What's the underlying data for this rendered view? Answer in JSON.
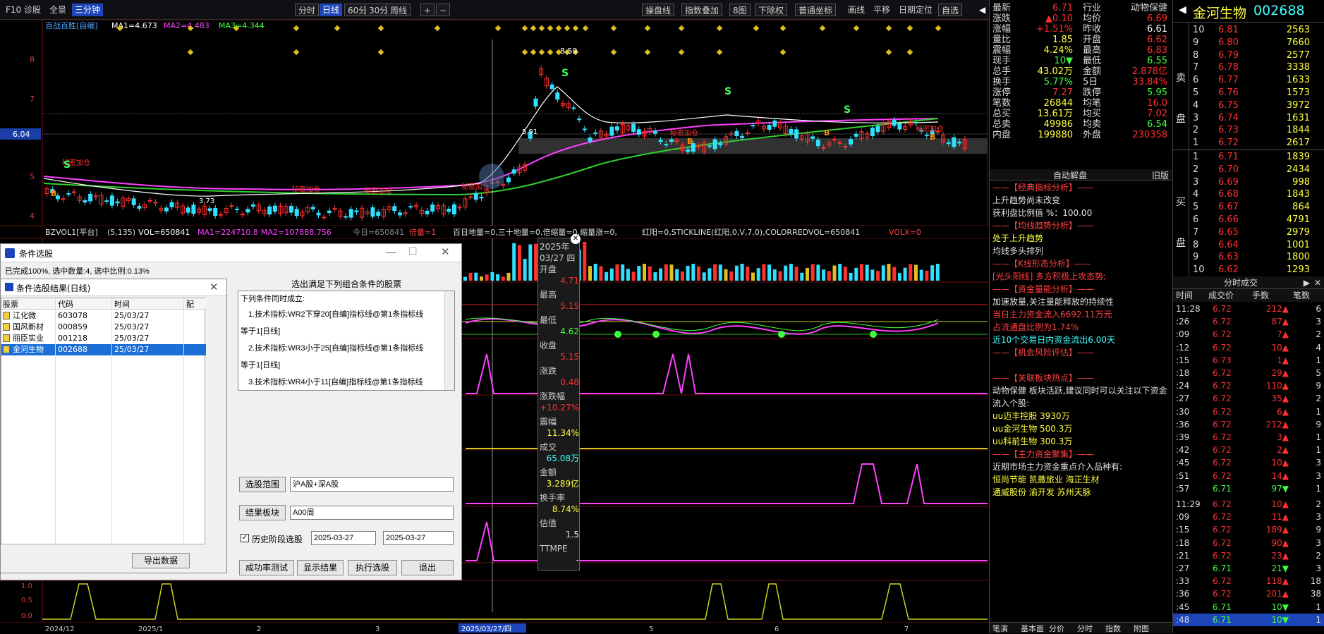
{
  "topbar": {
    "left_items": [
      "F10",
      "诊股",
      "全景",
      "三分钟"
    ],
    "period_tabs": [
      "分时",
      "日线",
      "60分",
      "30分",
      "周线"
    ],
    "right_items": [
      "操盘线",
      "指数叠加",
      "8图",
      "下除权",
      "普通坐标",
      "画线",
      "平移",
      "日期定位",
      "自选"
    ],
    "selected_left": "三分钟",
    "selected_period": "日线"
  },
  "main_chart": {
    "indicator_name": "百战百胜[自编]",
    "ma1": "MA1=4.673",
    "ma2": "MA2=4.483",
    "ma3": "MA3=4.344",
    "y_ticks": [
      "8",
      "7",
      "6",
      "5",
      "4"
    ],
    "price_marker": "6.04",
    "high_label": "8.59",
    "low_label": "3.73",
    "mid_label": "5.91",
    "annotations": [
      "秘密加仓",
      "秘密加仓",
      "秘密加仓",
      "秘密加仓",
      "秘密加仓",
      "秘密加仓"
    ],
    "buy_mark": "B",
    "sell_mark": "S"
  },
  "vol_bar": {
    "name": "BZVOL1[平台]",
    "params": "(5,135)",
    "vol": "VOL=650841",
    "ma1": "MA1=224710.8",
    "ma2": "MA2=107888.756",
    "today": "今日=650841",
    "ratio": "倍量=1",
    "rest": "百日地量=0,三十地量=0,倍缩量=0,缩量涨=0,",
    "rest2": "红阳=0,STICKLINE(红阳,0,V,7,0),COLORREDVOL=650841",
    "volx": "VOLX=0"
  },
  "x_axis": {
    "labels": [
      "2024/12",
      "2025/1",
      "2",
      "3",
      "2025/03/27/四",
      "5",
      "6",
      "7"
    ],
    "bottom_y": [
      "1.0",
      "0.5",
      "0.0"
    ]
  },
  "quote": {
    "rows": [
      {
        "l": "最新",
        "v": "6.71",
        "l2": "行业",
        "v2": "动物保健"
      },
      {
        "l": "涨跌",
        "v": "▲0.10",
        "l2": "均价",
        "v2": "6.69"
      },
      {
        "l": "涨幅",
        "v": "+1.51%",
        "l2": "昨收",
        "v2": "6.61"
      },
      {
        "l": "量比",
        "v": "1.85",
        "l2": "开盘",
        "v2": "6.62"
      },
      {
        "l": "震幅",
        "v": "4.24%",
        "l2": "最高",
        "v2": "6.83"
      },
      {
        "l": "现手",
        "v": "10▼",
        "l2": "最低",
        "v2": "6.55"
      },
      {
        "l": "总手",
        "v": "43.02万",
        "l2": "金额",
        "v2": "2.878亿"
      },
      {
        "l": "换手",
        "v": "5.77%",
        "l2": "5日",
        "v2": "33.84%"
      },
      {
        "l": "涨停",
        "v": "7.27",
        "l2": "跌停",
        "v2": "5.95"
      },
      {
        "l": "笔数",
        "v": "26844",
        "l2": "均笔",
        "v2": "16.0"
      },
      {
        "l": "总买",
        "v": "13.61万",
        "l2": "均买",
        "v2": "7.02"
      },
      {
        "l": "总卖",
        "v": "49986",
        "l2": "均卖",
        "v2": "6.54"
      },
      {
        "l": "内盘",
        "v": "199880",
        "l2": "外盘",
        "v2": "230358"
      }
    ]
  },
  "title": {
    "name": "金河生物",
    "code": "002688"
  },
  "book": {
    "sell_label": "卖盘",
    "buy_label": "买盘",
    "sell": [
      {
        "n": "10",
        "p": "6.81",
        "q": "2563"
      },
      {
        "n": "9",
        "p": "6.80",
        "q": "7660"
      },
      {
        "n": "8",
        "p": "6.79",
        "q": "2577"
      },
      {
        "n": "7",
        "p": "6.78",
        "q": "3338"
      },
      {
        "n": "6",
        "p": "6.77",
        "q": "1633"
      },
      {
        "n": "5",
        "p": "6.76",
        "q": "1573"
      },
      {
        "n": "4",
        "p": "6.75",
        "q": "3972"
      },
      {
        "n": "3",
        "p": "6.74",
        "q": "1631"
      },
      {
        "n": "2",
        "p": "6.73",
        "q": "1844"
      },
      {
        "n": "1",
        "p": "6.72",
        "q": "2617"
      }
    ],
    "buy": [
      {
        "n": "1",
        "p": "6.71",
        "q": "1839"
      },
      {
        "n": "2",
        "p": "6.70",
        "q": "2434"
      },
      {
        "n": "3",
        "p": "6.69",
        "q": "998"
      },
      {
        "n": "4",
        "p": "6.68",
        "q": "1843"
      },
      {
        "n": "5",
        "p": "6.67",
        "q": "864"
      },
      {
        "n": "6",
        "p": "6.66",
        "q": "4791"
      },
      {
        "n": "7",
        "p": "6.65",
        "q": "2979"
      },
      {
        "n": "8",
        "p": "6.64",
        "q": "1001"
      },
      {
        "n": "9",
        "p": "6.63",
        "q": "1800"
      },
      {
        "n": "10",
        "p": "6.62",
        "q": "1293"
      }
    ]
  },
  "analysis": {
    "header": "自动解盘",
    "header_right": "旧版",
    "lines": [
      {
        "t": "——【经典指标分析】——",
        "c": "#ff4040"
      },
      {
        "t": "上升趋势尚未改变",
        "c": "#e0e0e0"
      },
      {
        "t": "获利盘比例值 %：100.00",
        "c": "#e0e0e0"
      },
      {
        "t": "——【均线趋势分析】——",
        "c": "#ff4040"
      },
      {
        "t": "处于上升趋势",
        "c": "#ffff40"
      },
      {
        "t": "均线多头排列",
        "c": "#e0e0e0"
      },
      {
        "t": "——【K线形态分析】——",
        "c": "#ff4040"
      },
      {
        "t": "[光头阳线] 多方积极上攻态势;",
        "c": "#ff4040"
      },
      {
        "t": "——【资金量能分析】——",
        "c": "#ff4040"
      },
      {
        "t": "加速放量,关注量能释放的持续性",
        "c": "#e0e0e0"
      },
      {
        "t": "当日主力资金流入6692.11万元",
        "c": "#ff4040"
      },
      {
        "t": "占流通盘比例为1.74%",
        "c": "#ff4040"
      },
      {
        "t": "近10个交易日内资金流出6.00天",
        "c": "#40ffff"
      },
      {
        "t": "——【机会风险评估】——",
        "c": "#ff4040"
      },
      {
        "t": "",
        "c": "#e0e0e0"
      },
      {
        "t": "——【关联板块热点】——",
        "c": "#ff4040"
      },
      {
        "t": "动物保健 板块活跃,建议同时可以关注以下资金",
        "c": "#e0e0e0"
      },
      {
        "t": "流入个股:",
        "c": "#e0e0e0"
      },
      {
        "t": "uu迈丰控股 3930万",
        "c": "#ffff40"
      },
      {
        "t": "uu金河生物 500.3万",
        "c": "#ffff40"
      },
      {
        "t": "uu科前生物 300.3万",
        "c": "#ffff40"
      },
      {
        "t": "——【主力资金聚集】——",
        "c": "#ff4040"
      },
      {
        "t": "近期市场主力资金重点介入品种有:",
        "c": "#e0e0e0"
      },
      {
        "t": "恒尚节能 凯撒旅业 海正生材",
        "c": "#ffff40"
      },
      {
        "t": "通威股份 渝开发 苏州天脉",
        "c": "#ffff40"
      }
    ],
    "bottom_tabs": [
      "笔演",
      "基本面",
      "分价",
      "分时",
      "指数",
      "附图"
    ]
  },
  "ticks": {
    "header": "分时成交",
    "cols": [
      "时间",
      "成交价",
      "手数",
      "笔数"
    ],
    "rows": [
      {
        "t": "11:28",
        "p": "6.72",
        "q": "212▲",
        "n": "6"
      },
      {
        "t": ":26",
        "p": "6.72",
        "q": "87▲",
        "n": "3"
      },
      {
        "t": ":09",
        "p": "6.72",
        "q": "7▲",
        "n": "2"
      },
      {
        "t": ":12",
        "p": "6.72",
        "q": "10▲",
        "n": "4"
      },
      {
        "t": ":15",
        "p": "6.73",
        "q": "1▲",
        "n": "1"
      },
      {
        "t": ":18",
        "p": "6.72",
        "q": "29▲",
        "n": "5"
      },
      {
        "t": ":24",
        "p": "6.72",
        "q": "110▲",
        "n": "9"
      },
      {
        "t": ":27",
        "p": "6.72",
        "q": "35▲",
        "n": "2"
      },
      {
        "t": ":30",
        "p": "6.72",
        "q": "6▲",
        "n": "1"
      },
      {
        "t": ":36",
        "p": "6.72",
        "q": "212▲",
        "n": "9"
      },
      {
        "t": ":39",
        "p": "6.72",
        "q": "3▲",
        "n": "1"
      },
      {
        "t": ":42",
        "p": "6.72",
        "q": "2▲",
        "n": "1"
      },
      {
        "t": ":45",
        "p": "6.72",
        "q": "10▲",
        "n": "3"
      },
      {
        "t": ":51",
        "p": "6.72",
        "q": "14▲",
        "n": "3"
      },
      {
        "t": ":57",
        "p": "6.71",
        "q": "97▼",
        "n": "1"
      },
      {
        "t": "11:29",
        "p": "6.72",
        "q": "10▲",
        "n": "2"
      },
      {
        "t": ":09",
        "p": "6.72",
        "q": "11▲",
        "n": "3"
      },
      {
        "t": ":15",
        "p": "6.72",
        "q": "189▲",
        "n": "9"
      },
      {
        "t": ":18",
        "p": "6.72",
        "q": "90▲",
        "n": "3"
      },
      {
        "t": ":21",
        "p": "6.72",
        "q": "23▲",
        "n": "2"
      },
      {
        "t": ":27",
        "p": "6.71",
        "q": "21▼",
        "n": "3"
      },
      {
        "t": ":33",
        "p": "6.72",
        "q": "118▲",
        "n": "18"
      },
      {
        "t": ":36",
        "p": "6.72",
        "q": "201▲",
        "n": "38"
      },
      {
        "t": ":45",
        "p": "6.71",
        "q": "10▼",
        "n": "1"
      },
      {
        "t": ":48",
        "p": "6.71",
        "q": "10▼",
        "n": "1"
      }
    ]
  },
  "dialog": {
    "title": "条件选股",
    "status": "已完成100%, 选中数量:4, 选中比例:0.13%",
    "heading": "选出满足下列组合条件的股票",
    "cond_header": "下列条件同时成立:",
    "conds": [
      "1.技术指标:WR2下穿20[自编]指标线@第1条指标线",
      "等于1[日线]",
      "2.技术指标:WR3小于25[自编]指标线@第1条指标线",
      "等于1[日线]",
      "3.技术指标:WR4小于11[自编]指标线@第1条指标线"
    ],
    "range_btn": "选股范围",
    "range_val": "沪A股+深A股",
    "block_btn": "结果板块",
    "block_val": "A00周",
    "history_label": "历史阶段选股",
    "date1": "2025-03-27",
    "date2": "2025-03-27",
    "buttons": [
      "成功率测试",
      "显示结果",
      "执行选股",
      "退出"
    ]
  },
  "results": {
    "title": "条件选股结果(日线)",
    "cols": [
      "股票",
      "代码",
      "时间",
      "配"
    ],
    "rows": [
      {
        "name": "江化微",
        "code": "603078",
        "time": "25/03/27"
      },
      {
        "name": "国风新材",
        "code": "000859",
        "time": "25/03/27"
      },
      {
        "name": "丽臣实业",
        "code": "001218",
        "time": "25/03/27"
      },
      {
        "name": "金河生物",
        "code": "002688",
        "time": "25/03/27"
      }
    ],
    "export_btn": "导出数据"
  },
  "popup": {
    "items": [
      {
        "l": "2025年",
        "v": ""
      },
      {
        "l": "03/27 四",
        "v": ""
      },
      {
        "l": "开盘",
        "v": "4.71"
      },
      {
        "l": "最高",
        "v": "5.15"
      },
      {
        "l": "最低",
        "v": "4.62"
      },
      {
        "l": "收盘",
        "v": "5.15"
      },
      {
        "l": "涨跌",
        "v": "0.48"
      },
      {
        "l": "涨跌幅",
        "v": "+10.27%"
      },
      {
        "l": "震幅",
        "v": "11.34%"
      },
      {
        "l": "成交",
        "v": "65.08万"
      },
      {
        "l": "金额",
        "v": "3.289亿"
      },
      {
        "l": "换手率",
        "v": "8.74%"
      },
      {
        "l": "估值",
        "v": "1.5"
      },
      {
        "l": "TTMPE",
        "v": "-"
      }
    ]
  }
}
